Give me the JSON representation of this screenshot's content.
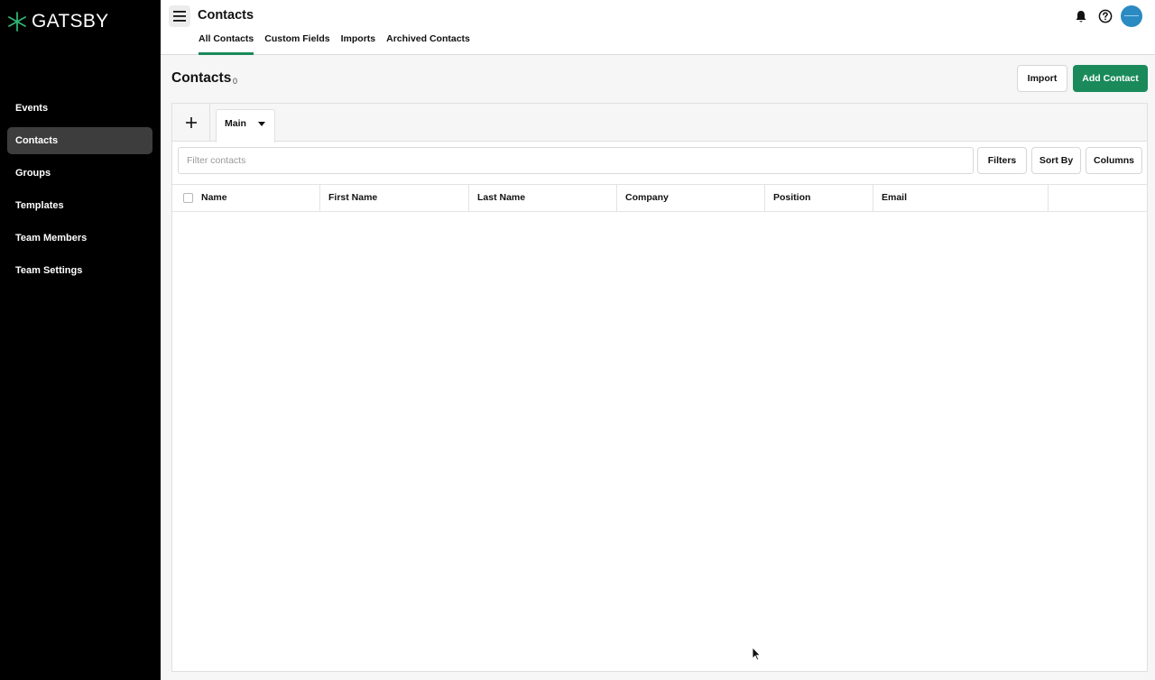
{
  "app": {
    "brand": "GATSBY"
  },
  "sidebar": {
    "items": [
      {
        "label": "Events"
      },
      {
        "label": "Contacts",
        "active": true
      },
      {
        "label": "Groups"
      },
      {
        "label": "Templates"
      },
      {
        "label": "Team Members"
      },
      {
        "label": "Team Settings"
      }
    ]
  },
  "header": {
    "title": "Contacts",
    "tabs": [
      {
        "label": "All Contacts",
        "active": true
      },
      {
        "label": "Custom Fields"
      },
      {
        "label": "Imports"
      },
      {
        "label": "Archived Contacts"
      }
    ],
    "icons": [
      "bell-icon",
      "help-icon",
      "avatar"
    ]
  },
  "main": {
    "title": "Contacts",
    "count": "0",
    "import_label": "Import",
    "add_label": "Add Contact",
    "view_tab": "Main",
    "filter_placeholder": "Filter contacts",
    "filters_label": "Filters",
    "sort_label": "Sort By",
    "columns_label": "Columns",
    "columns": [
      "Name",
      "First Name",
      "Last Name",
      "Company",
      "Position",
      "Email",
      ""
    ]
  },
  "colors": {
    "accent": "#1a8a5a",
    "sidebar_bg": "#000000",
    "sidebar_active": "#3d3d3d",
    "avatar": "#2a8ac2"
  }
}
